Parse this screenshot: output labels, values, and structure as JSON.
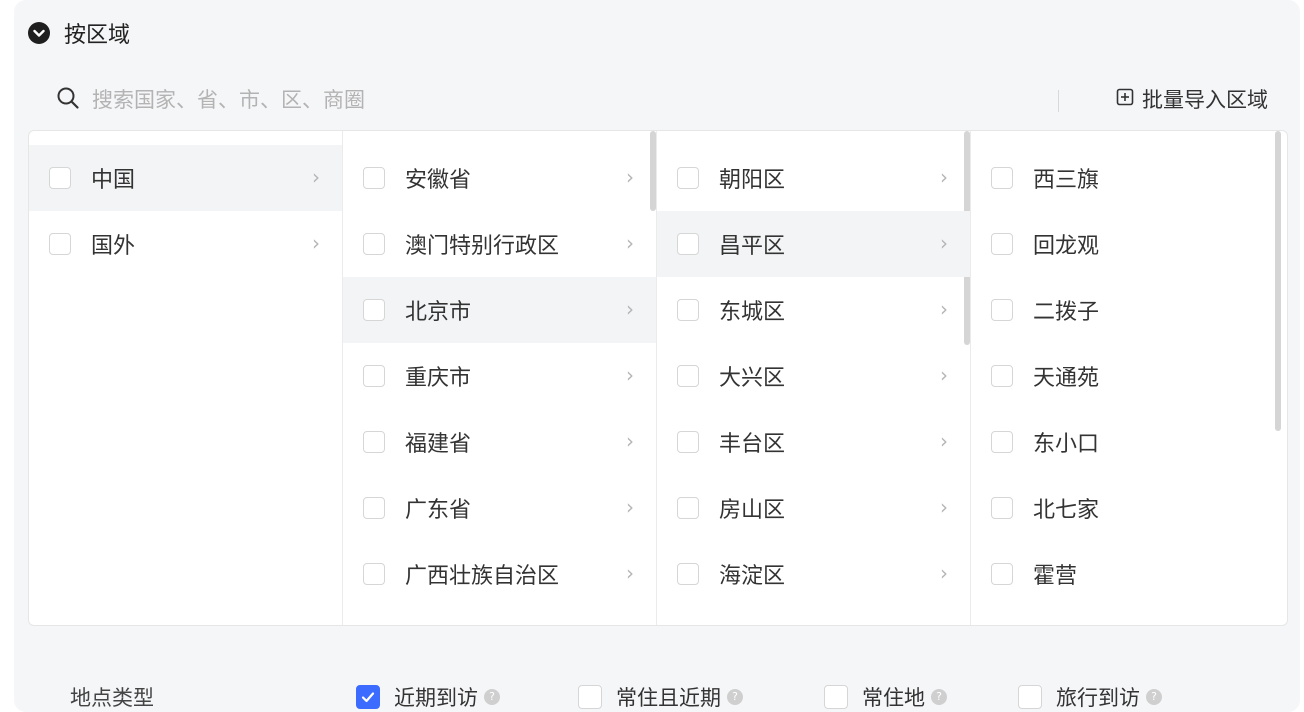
{
  "header": {
    "title": "按区域"
  },
  "search": {
    "placeholder": "搜索国家、省、市、区、商圈"
  },
  "batch_import": {
    "label": "批量导入区域"
  },
  "columns": [
    {
      "items": [
        {
          "label": "中国",
          "active": true
        },
        {
          "label": "国外"
        }
      ]
    },
    {
      "items": [
        {
          "label": "安徽省"
        },
        {
          "label": "澳门特别行政区"
        },
        {
          "label": "北京市",
          "active": true
        },
        {
          "label": "重庆市"
        },
        {
          "label": "福建省"
        },
        {
          "label": "广东省"
        },
        {
          "label": "广西壮族自治区"
        }
      ]
    },
    {
      "items": [
        {
          "label": "朝阳区"
        },
        {
          "label": "昌平区",
          "active": true
        },
        {
          "label": "东城区"
        },
        {
          "label": "大兴区"
        },
        {
          "label": "丰台区"
        },
        {
          "label": "房山区"
        },
        {
          "label": "海淀区"
        }
      ]
    },
    {
      "items": [
        {
          "label": "西三旗"
        },
        {
          "label": "回龙观"
        },
        {
          "label": "二拨子"
        },
        {
          "label": "天通苑"
        },
        {
          "label": "东小口"
        },
        {
          "label": "北七家"
        },
        {
          "label": "霍营"
        }
      ]
    }
  ],
  "location_type": {
    "label": "地点类型",
    "options": [
      {
        "label": "近期到访",
        "checked": true
      },
      {
        "label": "常住且近期",
        "checked": false
      },
      {
        "label": "常住地",
        "checked": false
      },
      {
        "label": "旅行到访",
        "checked": false
      }
    ]
  },
  "colors": {
    "accent": "#3c6bff"
  }
}
